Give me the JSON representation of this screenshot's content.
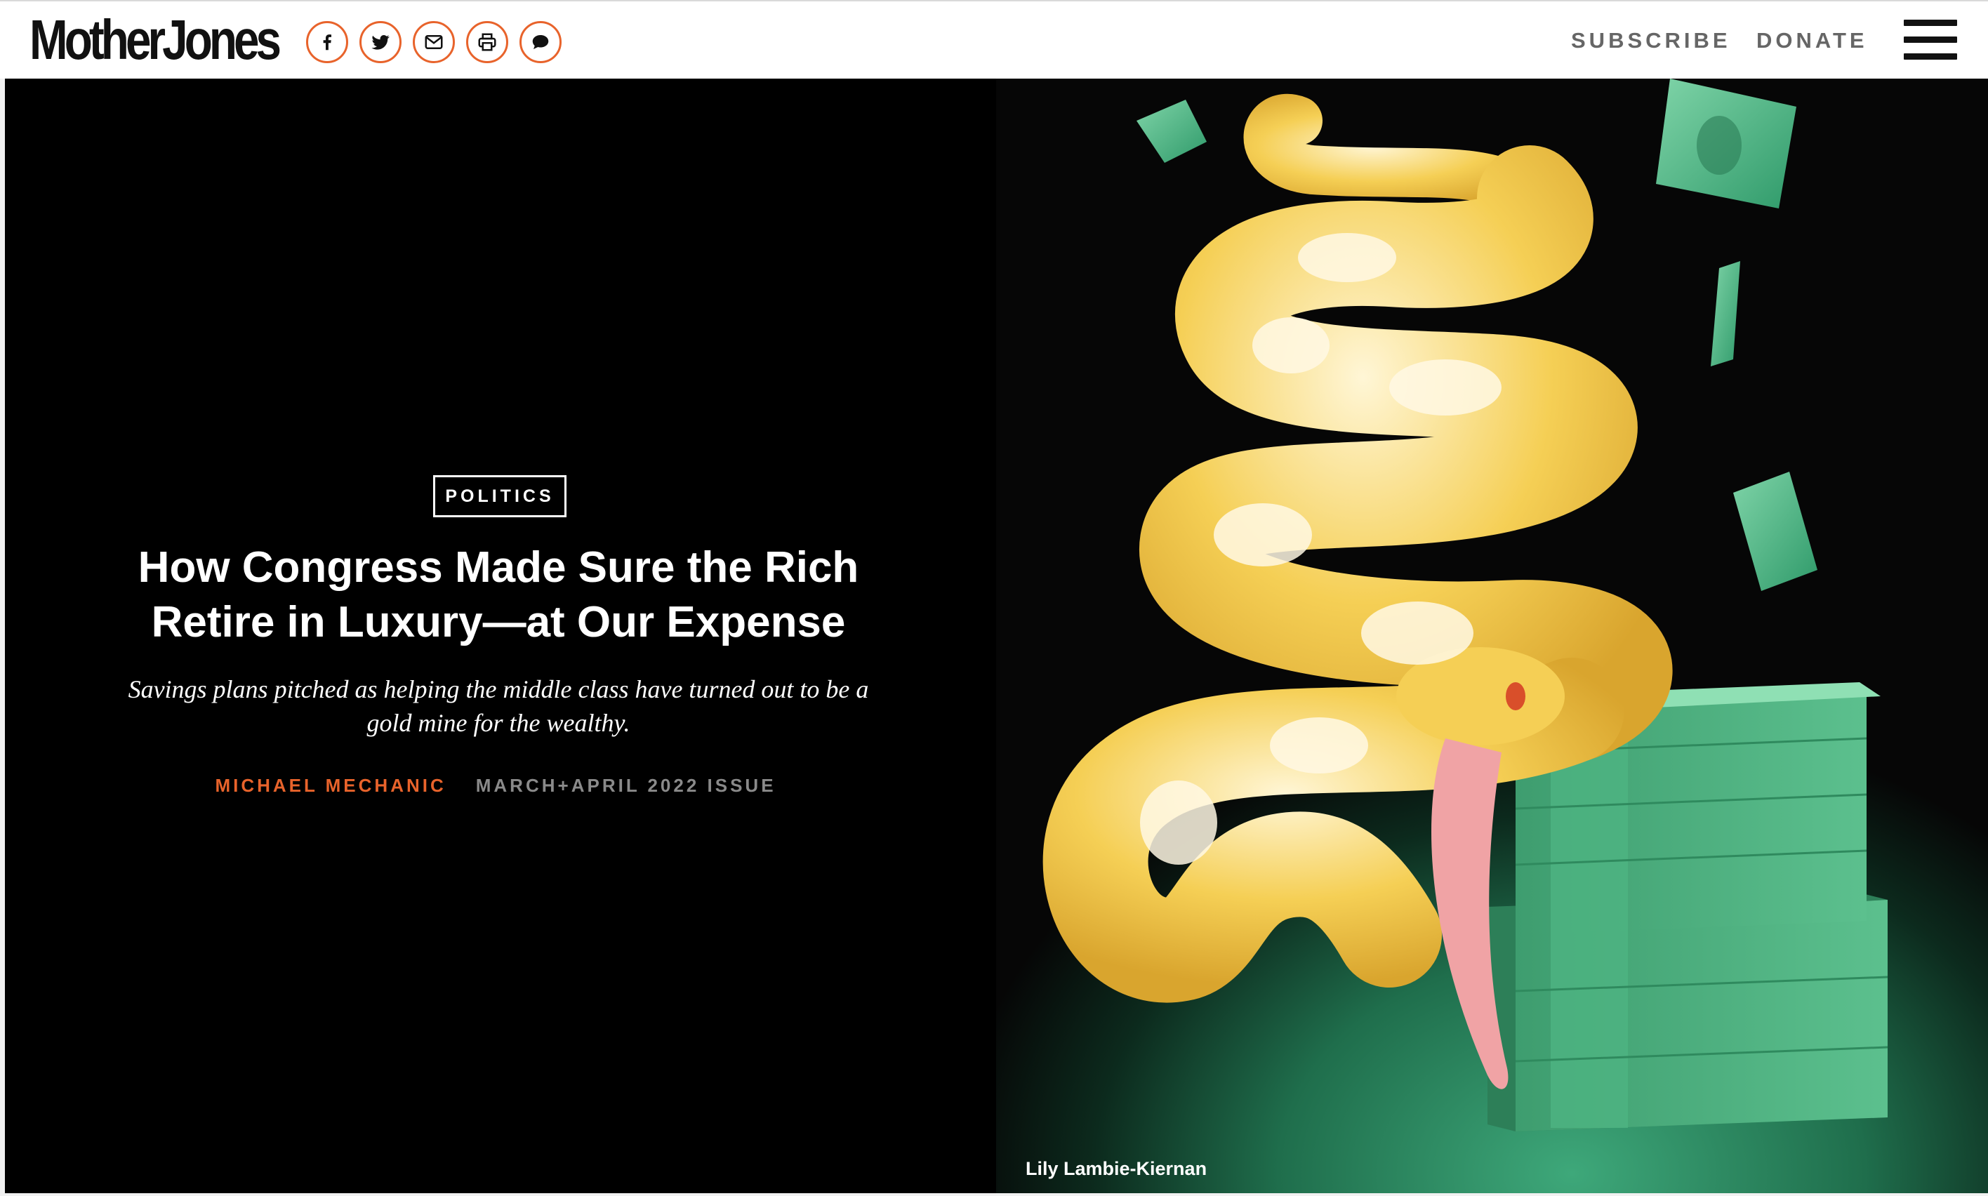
{
  "header": {
    "logo": "MotherJones",
    "share_icons": [
      "facebook-icon",
      "twitter-icon",
      "email-icon",
      "print-icon",
      "comment-icon"
    ],
    "nav": {
      "subscribe": "SUBSCRIBE",
      "donate": "DONATE"
    },
    "menu_icon": "hamburger-icon"
  },
  "article": {
    "category": "POLITICS",
    "headline": "How Congress Made Sure the Rich Retire in Luxury—at Our Expense",
    "dek": "Savings plans pitched as helping the middle class have turned out to be a gold mine for the wealthy.",
    "author": "MICHAEL MECHANIC",
    "issue": "MARCH+APRIL 2022 ISSUE",
    "image_credit": "Lily Lambie-Kiernan"
  },
  "colors": {
    "accent": "#e8632b",
    "hero_background": "#000000",
    "money_green": "#3ea87a",
    "snake_yellow": "#f2c44a"
  }
}
